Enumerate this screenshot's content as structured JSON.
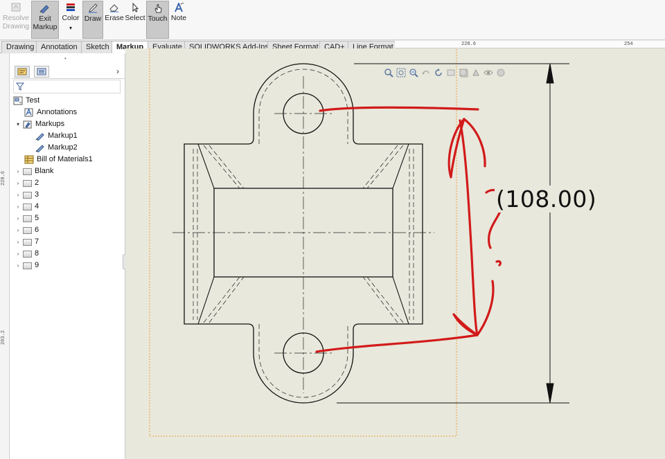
{
  "ribbon": {
    "buttons": [
      {
        "name": "resolve-drawing-button",
        "icon": "resolve-drawing-icon",
        "label": "Resolve Drawing",
        "line1": "Resolve",
        "line2": "Drawing",
        "state": "disabled"
      },
      {
        "name": "exit-markup-button",
        "icon": "exit-markup-icon",
        "label": "Exit Markup",
        "line1": "Exit",
        "line2": "Markup",
        "state": "active"
      },
      {
        "name": "color-button",
        "icon": "color-swatch-icon",
        "label": "Color",
        "line1": "Color",
        "line2": "",
        "state": "normal"
      },
      {
        "name": "draw-button",
        "icon": "pencil-icon",
        "label": "Draw",
        "line1": "Draw",
        "line2": "",
        "state": "active"
      },
      {
        "name": "erase-button",
        "icon": "eraser-icon",
        "label": "Erase",
        "line1": "Erase",
        "line2": "",
        "state": "normal"
      },
      {
        "name": "select-button",
        "icon": "cursor-icon",
        "label": "Select",
        "line1": "Select",
        "line2": "",
        "state": "normal"
      },
      {
        "name": "touch-button",
        "icon": "hand-icon",
        "label": "Touch",
        "line1": "Touch",
        "line2": "",
        "state": "active"
      },
      {
        "name": "note-button",
        "icon": "note-icon",
        "label": "Note",
        "line1": "Note",
        "line2": "",
        "state": "normal"
      }
    ],
    "color_dropdown_glyph": "▾"
  },
  "tabs": [
    {
      "label": "Drawing",
      "active": false
    },
    {
      "label": "Annotation",
      "active": false
    },
    {
      "label": "Sketch",
      "active": false
    },
    {
      "label": "Markup",
      "active": true
    },
    {
      "label": "Evaluate",
      "active": false
    },
    {
      "label": "SOLIDWORKS Add-Ins",
      "active": false
    },
    {
      "label": "Sheet Format",
      "active": false
    },
    {
      "label": "CAD+",
      "active": false
    },
    {
      "label": "Line Format",
      "active": false
    }
  ],
  "rulers": {
    "top_labels": [
      "228.6",
      "254"
    ],
    "left_labels": [
      "228.6",
      "203.2"
    ]
  },
  "panel": {
    "tabs": [
      {
        "icon": "feature-manager-icon",
        "active": true
      },
      {
        "icon": "property-manager-icon",
        "active": false
      }
    ],
    "expand_glyph": "›",
    "filter_icon": "filter-icon",
    "tree": [
      {
        "label": "Test",
        "level": 0,
        "expander": "",
        "icon": "drawing-icon"
      },
      {
        "label": "Annotations",
        "level": 1,
        "expander": "",
        "icon": "annotations-icon"
      },
      {
        "label": "Markups",
        "level": 1,
        "expander": "▾",
        "icon": "markups-folder-icon"
      },
      {
        "label": "Markup1",
        "level": 2,
        "expander": "",
        "icon": "markup-icon"
      },
      {
        "label": "Markup2",
        "level": 2,
        "expander": "",
        "icon": "markup-icon"
      },
      {
        "label": "Bill of Materials1",
        "level": 1,
        "expander": "",
        "icon": "bom-icon"
      },
      {
        "label": "Blank",
        "level": 1,
        "expander": "›",
        "icon": "sheet-icon"
      },
      {
        "label": "2",
        "level": 1,
        "expander": "›",
        "icon": "sheet-icon"
      },
      {
        "label": "3",
        "level": 1,
        "expander": "›",
        "icon": "sheet-icon"
      },
      {
        "label": "4",
        "level": 1,
        "expander": "›",
        "icon": "sheet-icon"
      },
      {
        "label": "5",
        "level": 1,
        "expander": "›",
        "icon": "sheet-icon"
      },
      {
        "label": "6",
        "level": 1,
        "expander": "›",
        "icon": "sheet-icon"
      },
      {
        "label": "7",
        "level": 1,
        "expander": "›",
        "icon": "sheet-icon"
      },
      {
        "label": "8",
        "level": 1,
        "expander": "›",
        "icon": "sheet-icon"
      },
      {
        "label": "9",
        "level": 1,
        "expander": "›",
        "icon": "sheet-icon"
      }
    ]
  },
  "canvas": {
    "view_tools": [
      "zoom-to-fit-icon",
      "zoom-to-area-icon",
      "zoom-in-out-icon",
      "previous-view-icon",
      "redraw-icon",
      "section-view-icon",
      "view-orientation-icon",
      "display-style-icon",
      "hide-show-icon",
      "appearance-icon"
    ],
    "dimension_text": "108.00",
    "markup_color": "#d21a1a",
    "sheet_border_color": "#f0a040",
    "background_color": "#e8e8dc"
  }
}
